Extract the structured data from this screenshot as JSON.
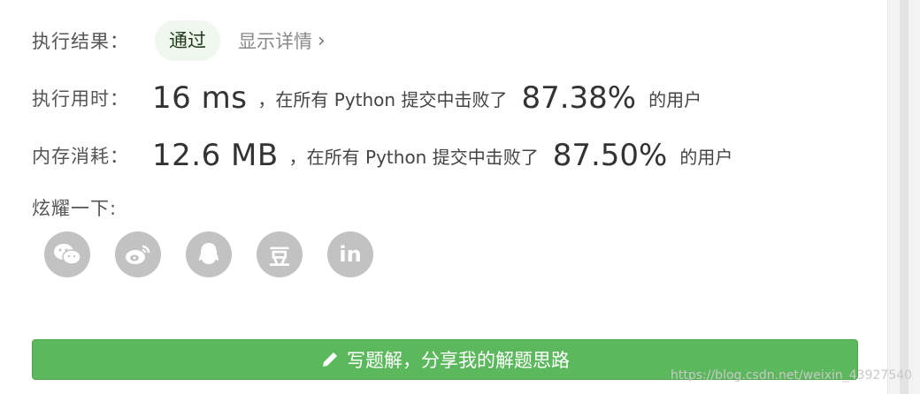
{
  "result": {
    "label": "执行结果：",
    "badge": "通过",
    "details_link": "显示详情",
    "details_chevron": "›"
  },
  "runtime": {
    "label": "执行用时：",
    "value": "16 ms",
    "text": "，在所有 Python 提交中击败了",
    "percent": "87.38%",
    "tail": "的用户"
  },
  "memory": {
    "label": "内存消耗：",
    "value": "12.6 MB",
    "text": "，在所有 Python 提交中击败了",
    "percent": "87.50%",
    "tail": "的用户"
  },
  "share": {
    "label": "炫耀一下:",
    "icons": [
      {
        "icon": "wechat-icon"
      },
      {
        "icon": "weibo-icon"
      },
      {
        "icon": "qq-icon"
      },
      {
        "icon": "douban-icon",
        "glyph": "豆"
      },
      {
        "icon": "linkedin-icon",
        "glyph": "in"
      }
    ]
  },
  "write_button": {
    "label": "写题解，分享我的解题思路",
    "icon": "pencil-icon",
    "color": "#5cb85c"
  },
  "watermark": "https://blog.csdn.net/weixin_43927540"
}
